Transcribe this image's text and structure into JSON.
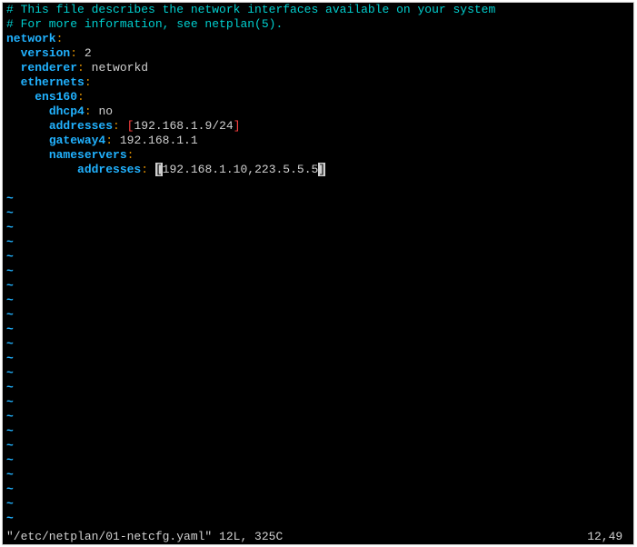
{
  "file": {
    "comment1": "# This file describes the network interfaces available on your system",
    "comment2": "# For more information, see netplan(5).",
    "k_network": "network",
    "k_version": "version",
    "v_version": " 2",
    "k_renderer": "renderer",
    "v_renderer": " networkd",
    "k_ethernets": "ethernets",
    "k_iface": "ens160",
    "k_dhcp4": "dhcp4",
    "v_dhcp4": " no",
    "k_addresses": "addresses",
    "v_addr_ip": "192.168.1.9/24",
    "k_gateway4": "gateway4",
    "v_gateway4": " 192.168.1.1",
    "k_nameservers": "nameservers",
    "k_ns_addresses": "addresses",
    "v_ns_addr": "192.168.1.10,223.5.5.5"
  },
  "colon": ":",
  "lbracket": "[",
  "rbracket": "]",
  "tilde": "~",
  "status": {
    "left": "\"/etc/netplan/01-netcfg.yaml\" 12L, 325C",
    "right": "12,49 "
  },
  "indent": {
    "i2": "  ",
    "i4": "    ",
    "i6": "      ",
    "i10": "          "
  }
}
